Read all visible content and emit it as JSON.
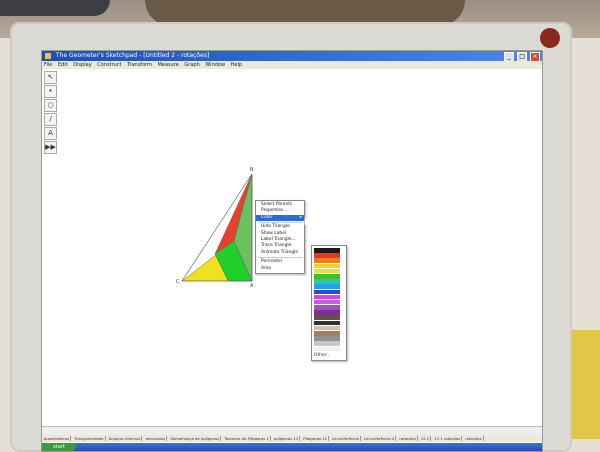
{
  "window": {
    "title": "The Geometer's Sketchpad - [Untitled 2 - rotações]",
    "controls": {
      "minimize": "_",
      "maximize": "□",
      "close": "×"
    }
  },
  "menubar": [
    "File",
    "Edit",
    "Display",
    "Construct",
    "Transform",
    "Measure",
    "Graph",
    "Window",
    "Help"
  ],
  "toolbox": [
    {
      "name": "arrow-tool-icon",
      "glyph": "↖"
    },
    {
      "name": "point-tool-icon",
      "glyph": "•"
    },
    {
      "name": "compass-tool-icon",
      "glyph": "○"
    },
    {
      "name": "straightedge-tool-icon",
      "glyph": "/"
    },
    {
      "name": "text-tool-icon",
      "glyph": "A"
    },
    {
      "name": "custom-tool-icon",
      "glyph": "▶▶"
    }
  ],
  "points": {
    "top": "B",
    "left": "C",
    "bottom": "A"
  },
  "context_menu": {
    "items": [
      {
        "label": "Select Parents",
        "highlighted": false
      },
      {
        "label": "Properties...",
        "highlighted": false
      },
      {
        "label": "Color",
        "highlighted": true,
        "submenu": true
      },
      {
        "label": "Hide Triangle",
        "highlighted": false
      },
      {
        "label": "Show Label",
        "highlighted": false
      },
      {
        "label": "Label Triangle...",
        "highlighted": false
      },
      {
        "label": "Trace Triangle",
        "highlighted": false
      },
      {
        "label": "Animate Triangle",
        "highlighted": false
      },
      {
        "label": "Perimeter",
        "highlighted": false
      },
      {
        "label": "Area",
        "highlighted": false
      }
    ]
  },
  "palette": {
    "colors": [
      "#1a1a1a",
      "#e0382a",
      "#f07a20",
      "#f5d020",
      "#e8e040",
      "#38c038",
      "#2ec8a0",
      "#24a0e8",
      "#2a48d0",
      "#e040e0",
      "#c060e0",
      "#a050c0",
      "#7a3090",
      "#6a5040",
      "#303030",
      "#d8c0a0",
      "#a08060",
      "#909090",
      "#c8c8c8",
      "#f0f0f0"
    ],
    "other_label": "Other..."
  },
  "shapes_colors": {
    "red": "#e8402c",
    "yellow": "#f0e020",
    "green": "#20d02a",
    "light_green": "#6cc060"
  },
  "tabs": [
    "quadrilateros",
    "Triangularidade",
    "Ângulos internos",
    "retrovador",
    "Semelhança de polígonos",
    "Teorema de Pitágoras 1",
    "polígonos 13",
    "Pitágoras 11",
    "circunferência",
    "circunferência 2",
    "rotações",
    "12.1",
    "12.1 rotações",
    "rotações"
  ],
  "taskbar": {
    "start": "start"
  }
}
